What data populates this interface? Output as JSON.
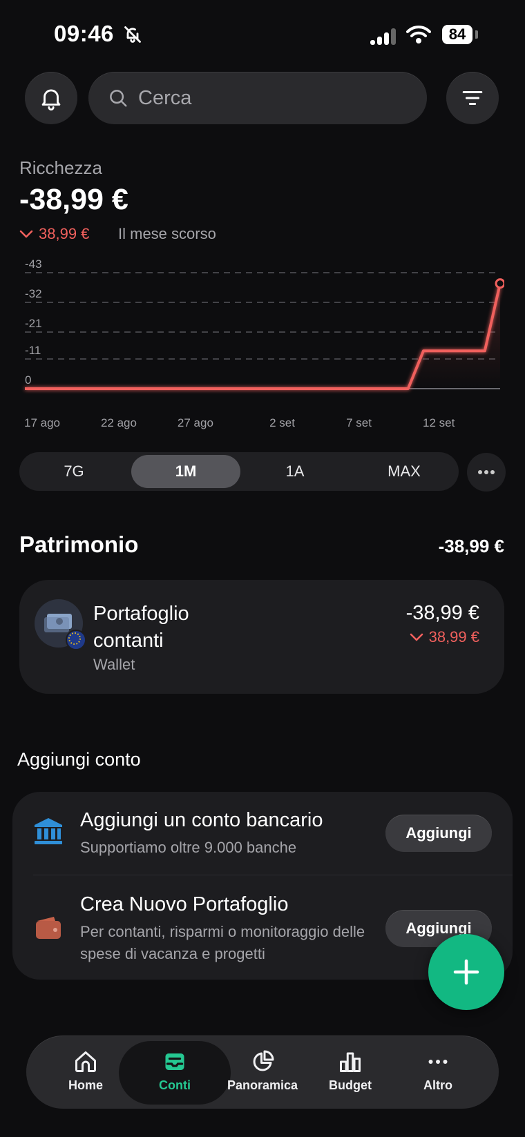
{
  "status_bar": {
    "time": "09:46",
    "battery": "84"
  },
  "search": {
    "placeholder": "Cerca"
  },
  "wealth": {
    "label": "Ricchezza",
    "value": "-38,99 €",
    "change": "38,99 €",
    "period": "Il mese scorso"
  },
  "chart_data": {
    "type": "line",
    "x_ticks": [
      "17 ago",
      "22 ago",
      "27 ago",
      "2 set",
      "7 set",
      "12 set"
    ],
    "y_ticks": [
      "-43",
      "-32",
      "-21",
      "-11",
      "0"
    ],
    "series": [
      {
        "x": [
          "17 ago",
          "22 ago",
          "27 ago",
          "2 set",
          "7 set",
          "11 set",
          "12 set",
          "14 set",
          "16 set",
          "17 set"
        ],
        "values": [
          0,
          0,
          0,
          0,
          0,
          0,
          -14,
          -14,
          -14,
          -39
        ]
      }
    ],
    "line_color": "#f0605d",
    "grid": true
  },
  "range_selector": {
    "options": [
      "7G",
      "1M",
      "1A",
      "MAX"
    ],
    "selected": "1M"
  },
  "patrimonio": {
    "title": "Patrimonio",
    "total": "-38,99 €",
    "account": {
      "name": "Portafoglio contanti",
      "type": "Wallet",
      "value": "-38,99 €",
      "change": "38,99 €"
    }
  },
  "add_account": {
    "title": "Aggiungi conto",
    "rows": [
      {
        "title": "Aggiungi un conto bancario",
        "subtitle": "Supportiamo oltre 9.000 banche",
        "button": "Aggiungi",
        "icon": "bank-icon"
      },
      {
        "title": "Crea Nuovo Portafoglio",
        "subtitle": "Per contanti, risparmi o monitoraggio delle spese di vacanza e progetti",
        "button": "Aggiungi",
        "icon": "wallet-icon"
      }
    ]
  },
  "bottom_nav": {
    "items": [
      {
        "label": "Home",
        "icon": "home-icon"
      },
      {
        "label": "Conti",
        "icon": "accounts-icon"
      },
      {
        "label": "Panoramica",
        "icon": "pie-chart-icon"
      },
      {
        "label": "Budget",
        "icon": "bar-chart-icon"
      },
      {
        "label": "Altro",
        "icon": "more-icon"
      }
    ],
    "active": "Conti"
  },
  "colors": {
    "accent": "#12b882",
    "negative": "#f0605d",
    "background": "#0d0d0f"
  }
}
